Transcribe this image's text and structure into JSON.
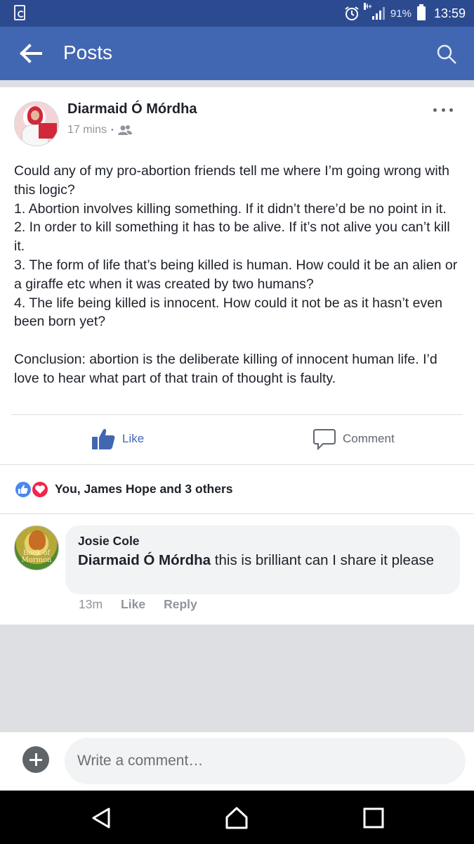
{
  "status_bar": {
    "battery_percent": "91%",
    "time": "13:59",
    "network": "H+"
  },
  "app_bar": {
    "title": "Posts"
  },
  "post": {
    "author": "Diarmaid Ó Mórdha",
    "time_ago": "17 mins",
    "privacy_separator": "•",
    "paragraphs": [
      "Could any of my pro-abortion friends tell me where I’m going wrong with this logic?",
      "1. Abortion involves killing something. If it didn’t there’d be no point in it.",
      "2. In order to kill something it has to be alive. If it’s not alive you can’t kill it.",
      "3. The form of life that’s being killed is human. How could it be an alien or a giraffe etc when it was created by two humans?",
      "4. The life being killed is innocent. How could it not be as it hasn’t even been born yet?",
      "",
      "Conclusion: abortion is the deliberate killing of innocent human life. I’d love to hear what part of that train of thought is faulty."
    ],
    "like_label": "Like",
    "comment_label": "Comment",
    "reactions_text": "You, James Hope and 3 others"
  },
  "comment": {
    "author": "Josie Cole",
    "mention": "Diarmaid Ó Mórdha",
    "text": " this is brilliant can I share it please",
    "time_ago": "13m",
    "like_label": "Like",
    "reply_label": "Reply",
    "avatar_text": "Book of Mormon"
  },
  "composer": {
    "placeholder": "Write a comment…"
  },
  "colors": {
    "brand": "#4267b2",
    "status_bar": "#2c4a8f",
    "like_reaction": "#4a88f0",
    "love_reaction": "#f0284a"
  },
  "icons": [
    "sim-card-icon",
    "alarm-icon",
    "signal-icon",
    "battery-icon",
    "back-arrow-icon",
    "search-icon",
    "more-options-icon",
    "friends-privacy-icon",
    "like-thumb-icon",
    "comment-bubble-icon",
    "like-reaction-icon",
    "love-reaction-icon",
    "add-attachment-icon",
    "nav-back-icon",
    "nav-home-icon",
    "nav-recents-icon"
  ]
}
